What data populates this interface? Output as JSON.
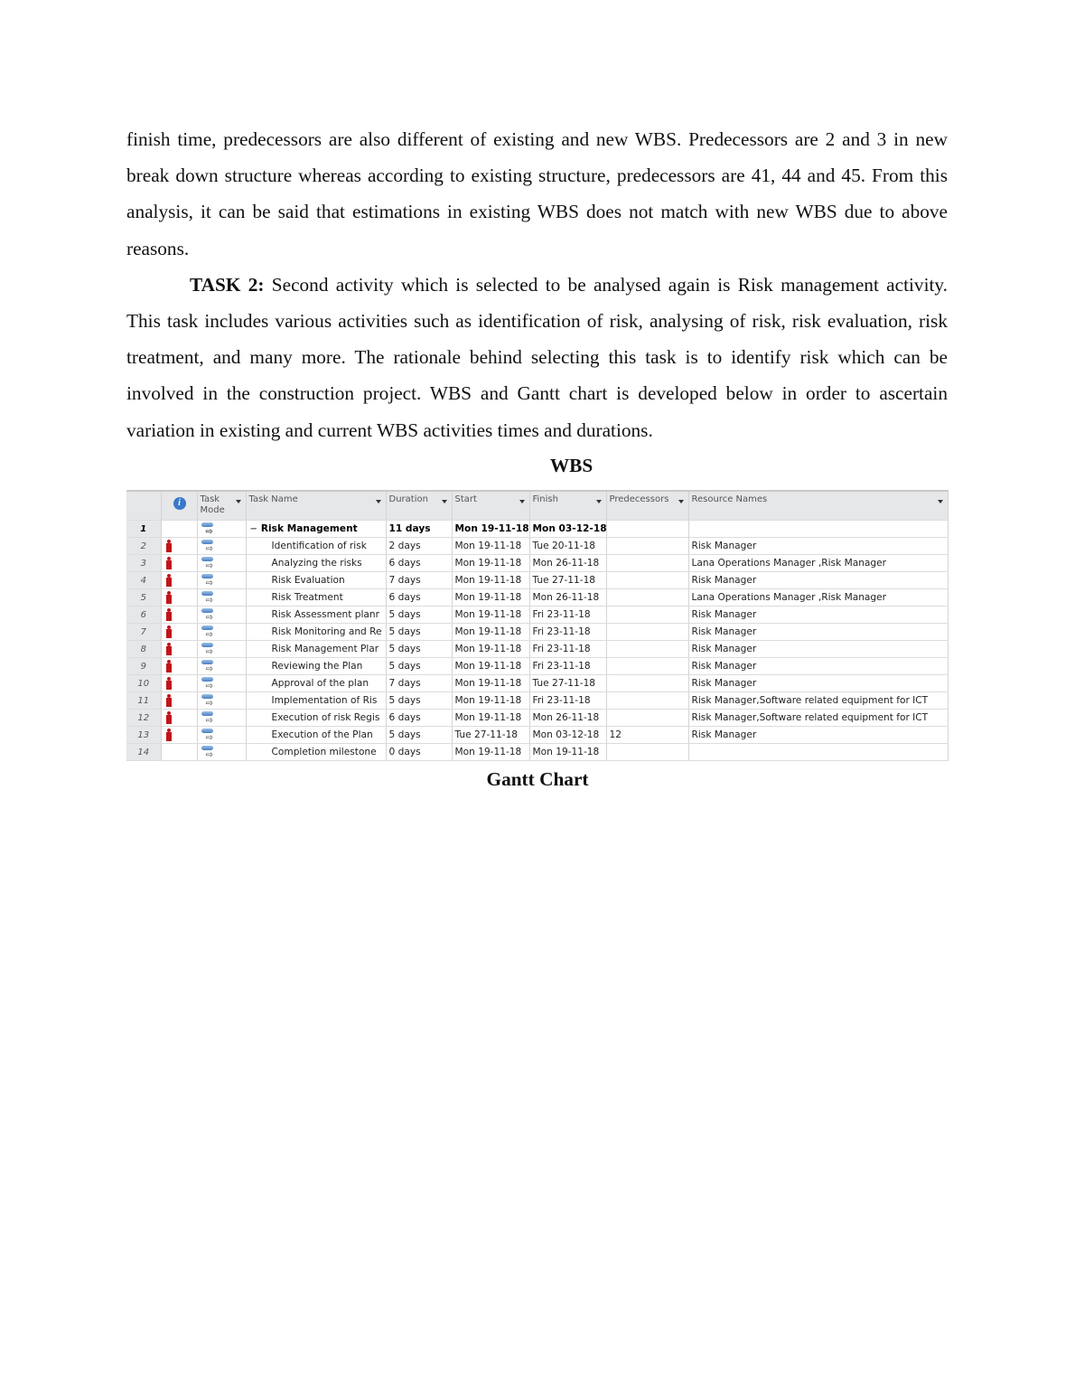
{
  "paragraphs": {
    "p1": "finish time, predecessors are also different of existing and new WBS. Predecessors are 2 and 3 in new break down structure whereas according to existing structure, predecessors are 41, 44 and 45. From this analysis, it can be said that estimations in existing WBS does not match with new WBS due to above reasons.",
    "p2_label": "TASK 2:",
    "p2": " Second activity which is selected to be analysed again is Risk management activity. This task includes various activities such as identification of risk, analysing of risk, risk evaluation, risk treatment, and many more. The rationale behind selecting this task is to identify risk which can be involved in the construction project. WBS and Gantt chart is developed below in order to ascertain variation in existing and current WBS activities times and durations."
  },
  "captions": {
    "wbs": "WBS",
    "gantt": "Gantt Chart"
  },
  "table": {
    "headers": {
      "info": "i",
      "task_mode": "Task Mode",
      "task_name": "Task Name",
      "duration": "Duration",
      "start": "Start",
      "finish": "Finish",
      "predecessors": "Predecessors",
      "resource_names": "Resource Names"
    },
    "collapse_symbol": "−",
    "arrow_glyph": "⇨",
    "rows": [
      {
        "id": "1",
        "name": "Risk Management",
        "duration": "11 days",
        "start": "Mon 19-11-18",
        "finish": "Mon 03-12-18",
        "pred": "",
        "res": ""
      },
      {
        "id": "2",
        "name": "Identification of risk",
        "duration": "2 days",
        "start": "Mon 19-11-18",
        "finish": "Tue 20-11-18",
        "pred": "",
        "res": "Risk Manager"
      },
      {
        "id": "3",
        "name": "Analyzing the risks",
        "duration": "6 days",
        "start": "Mon 19-11-18",
        "finish": "Mon 26-11-18",
        "pred": "",
        "res": "Lana Operations Manager ,Risk Manager"
      },
      {
        "id": "4",
        "name": "Risk Evaluation",
        "duration": "7 days",
        "start": "Mon 19-11-18",
        "finish": "Tue 27-11-18",
        "pred": "",
        "res": "Risk Manager"
      },
      {
        "id": "5",
        "name": "Risk Treatment",
        "duration": "6 days",
        "start": "Mon 19-11-18",
        "finish": "Mon 26-11-18",
        "pred": "",
        "res": "Lana Operations Manager ,Risk Manager"
      },
      {
        "id": "6",
        "name": "Risk Assessment planr",
        "duration": "5 days",
        "start": "Mon 19-11-18",
        "finish": "Fri 23-11-18",
        "pred": "",
        "res": "Risk Manager"
      },
      {
        "id": "7",
        "name": "Risk Monitoring and Re",
        "duration": "5 days",
        "start": "Mon 19-11-18",
        "finish": "Fri 23-11-18",
        "pred": "",
        "res": "Risk Manager"
      },
      {
        "id": "8",
        "name": "Risk Management Plar",
        "duration": "5 days",
        "start": "Mon 19-11-18",
        "finish": "Fri 23-11-18",
        "pred": "",
        "res": "Risk Manager"
      },
      {
        "id": "9",
        "name": "Reviewing the Plan",
        "duration": "5 days",
        "start": "Mon 19-11-18",
        "finish": "Fri 23-11-18",
        "pred": "",
        "res": "Risk Manager"
      },
      {
        "id": "10",
        "name": "Approval of the plan",
        "duration": "7 days",
        "start": "Mon 19-11-18",
        "finish": "Tue 27-11-18",
        "pred": "",
        "res": "Risk Manager"
      },
      {
        "id": "11",
        "name": "Implementation of Ris",
        "duration": "5 days",
        "start": "Mon 19-11-18",
        "finish": "Fri 23-11-18",
        "pred": "",
        "res": "Risk Manager,Software related equipment for ICT"
      },
      {
        "id": "12",
        "name": "Execution of risk Regis",
        "duration": "6 days",
        "start": "Mon 19-11-18",
        "finish": "Mon 26-11-18",
        "pred": "",
        "res": "Risk Manager,Software related equipment for ICT"
      },
      {
        "id": "13",
        "name": "Execution of the Plan",
        "duration": "5 days",
        "start": "Tue 27-11-18",
        "finish": "Mon 03-12-18",
        "pred": "12",
        "res": "Risk Manager"
      },
      {
        "id": "14",
        "name": "Completion milestone",
        "duration": "0 days",
        "start": "Mon 19-11-18",
        "finish": "Mon 19-11-18",
        "pred": "",
        "res": ""
      }
    ],
    "resource_indicator_rows": [
      "2",
      "3",
      "4",
      "5",
      "6",
      "7",
      "8",
      "9",
      "10",
      "11",
      "12",
      "13"
    ]
  }
}
